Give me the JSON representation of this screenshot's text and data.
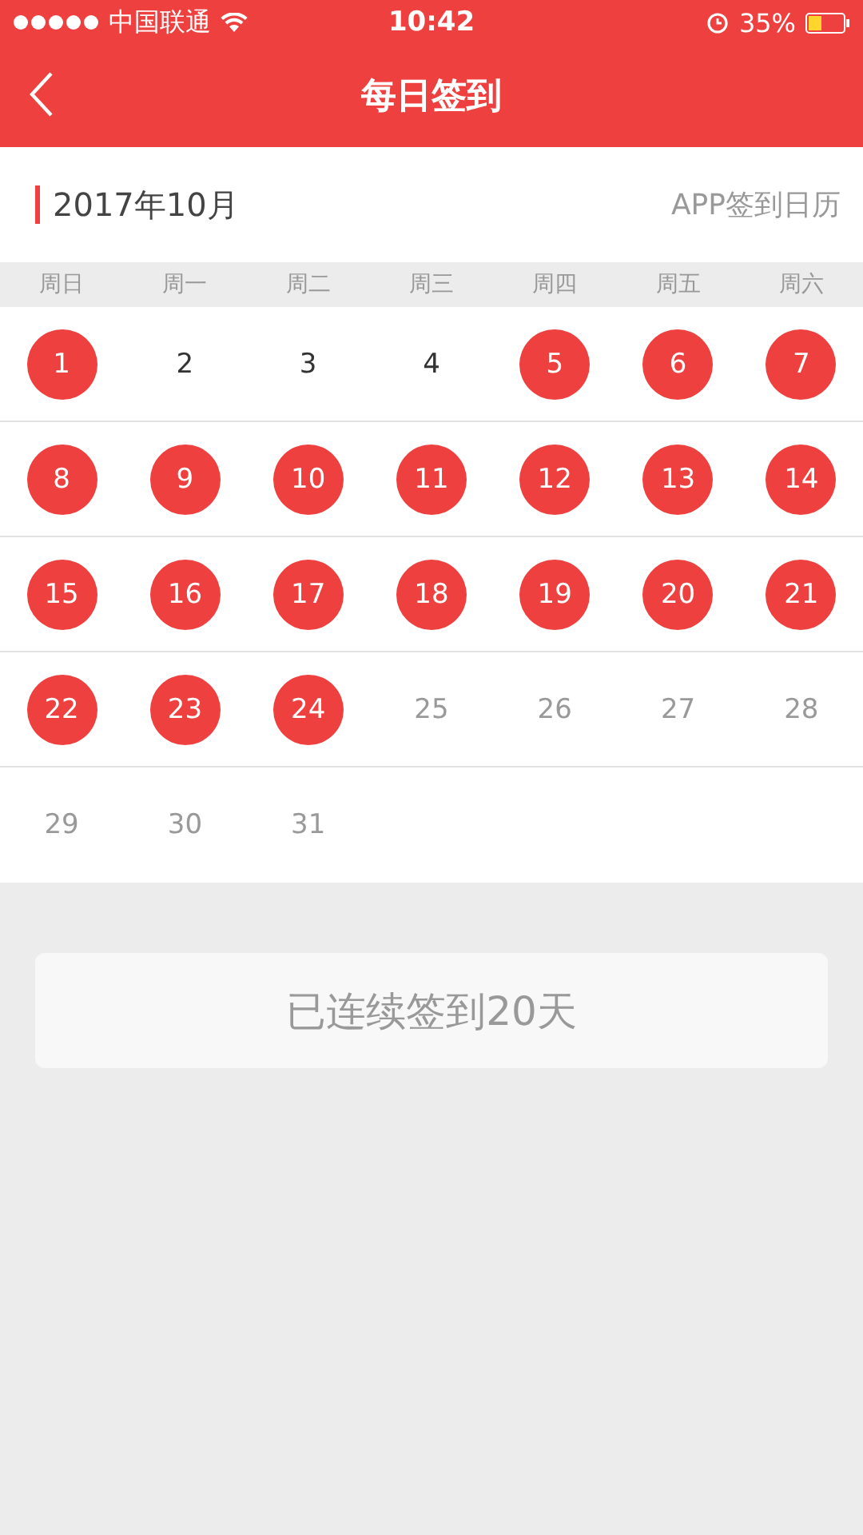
{
  "status_bar": {
    "carrier": "中国联通",
    "time": "10:42",
    "battery_text": "35%"
  },
  "nav": {
    "title": "每日签到"
  },
  "calendar": {
    "month": "2017年10月",
    "caption": "APP签到日历",
    "weekdays": [
      "周日",
      "周一",
      "周二",
      "周三",
      "周四",
      "周五",
      "周六"
    ],
    "days": [
      {
        "label": "1",
        "kind": "signed"
      },
      {
        "label": "2",
        "kind": "missed"
      },
      {
        "label": "3",
        "kind": "missed"
      },
      {
        "label": "4",
        "kind": "missed"
      },
      {
        "label": "5",
        "kind": "signed"
      },
      {
        "label": "6",
        "kind": "signed"
      },
      {
        "label": "7",
        "kind": "signed"
      },
      {
        "label": "8",
        "kind": "signed"
      },
      {
        "label": "9",
        "kind": "signed"
      },
      {
        "label": "10",
        "kind": "signed"
      },
      {
        "label": "11",
        "kind": "signed"
      },
      {
        "label": "12",
        "kind": "signed"
      },
      {
        "label": "13",
        "kind": "signed"
      },
      {
        "label": "14",
        "kind": "signed"
      },
      {
        "label": "15",
        "kind": "signed"
      },
      {
        "label": "16",
        "kind": "signed"
      },
      {
        "label": "17",
        "kind": "signed"
      },
      {
        "label": "18",
        "kind": "signed"
      },
      {
        "label": "19",
        "kind": "signed"
      },
      {
        "label": "20",
        "kind": "signed"
      },
      {
        "label": "21",
        "kind": "signed"
      },
      {
        "label": "22",
        "kind": "signed"
      },
      {
        "label": "23",
        "kind": "signed"
      },
      {
        "label": "24",
        "kind": "signed"
      },
      {
        "label": "25",
        "kind": "future"
      },
      {
        "label": "26",
        "kind": "future"
      },
      {
        "label": "27",
        "kind": "future"
      },
      {
        "label": "28",
        "kind": "future"
      },
      {
        "label": "29",
        "kind": "future"
      },
      {
        "label": "30",
        "kind": "future"
      },
      {
        "label": "31",
        "kind": "future"
      }
    ]
  },
  "streak": {
    "text": "已连续签到20天"
  }
}
